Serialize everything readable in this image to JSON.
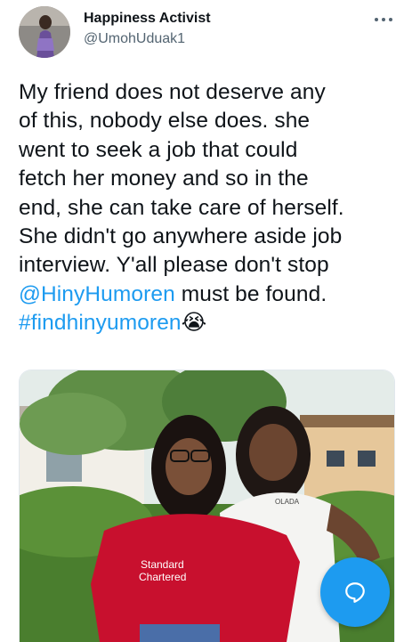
{
  "author": {
    "display_name": "Happiness Activist",
    "handle": "@UmohUduak1"
  },
  "tweet": {
    "line1": "My friend does not deserve any",
    "line2": "of this, nobody else does. she",
    "line3": "went to seek a job that could",
    "line4": "fetch her money and so in the",
    "line5": "end, she can take care of herself.",
    "line6": "She didn't go anywhere aside job",
    "line7": "interview.  Y'all please don't stop",
    "mention": "@HinyHumoren",
    "line8_rest": " must be found.",
    "hashtag": "#findhinyumoren",
    "emoji": "😭"
  },
  "photo": {
    "jersey_text_line1": "Standard",
    "jersey_text_line2": "Chartered",
    "shirt_text": "OLADA"
  },
  "icons": {
    "more": "more-horizontal-icon",
    "compose": "chat-bubble-icon"
  },
  "colors": {
    "link": "#1d9bf0",
    "fab": "#1d9bf0"
  }
}
